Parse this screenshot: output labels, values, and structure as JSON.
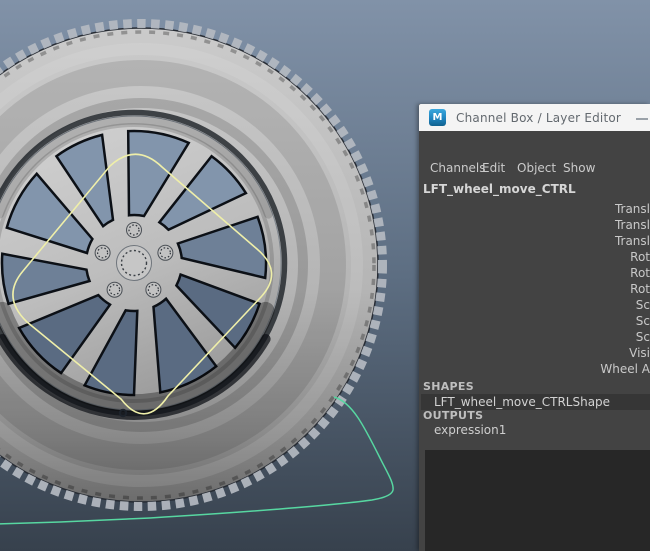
{
  "colors": {
    "bg_top": "#8192a8",
    "bg_mid": "#5d6e82",
    "bg_bottom": "#37414d",
    "yellow_curve": "#efefa9",
    "green_curve": "#57d7a1",
    "panel_bg": "#434343",
    "titlebar_bg": "#f4f4f4",
    "layer_area_bg": "#272727",
    "shape_row_bg": "#363636",
    "maya_icon_blue": "#1f84bf",
    "window_upper": "#8295ac",
    "window_mid": "#6e8097",
    "window_lower": "#5a6b82"
  },
  "panel": {
    "title": "Channel Box / Layer Editor",
    "icon_letter": "M",
    "menu": [
      "Channels",
      "Edit",
      "Object",
      "Show"
    ],
    "node_name": "LFT_wheel_move_CTRL",
    "attributes": [
      "Transl",
      "Transl",
      "Transl",
      "Rot",
      "Rot",
      "Rot",
      "Sc",
      "Sc",
      "Sc",
      "Visi",
      "Wheel A"
    ],
    "shapes_header": "SHAPES",
    "shape_name": "LFT_wheel_move_CTRLShape",
    "outputs_header": "OUTPUTS",
    "output_name": "expression1"
  }
}
